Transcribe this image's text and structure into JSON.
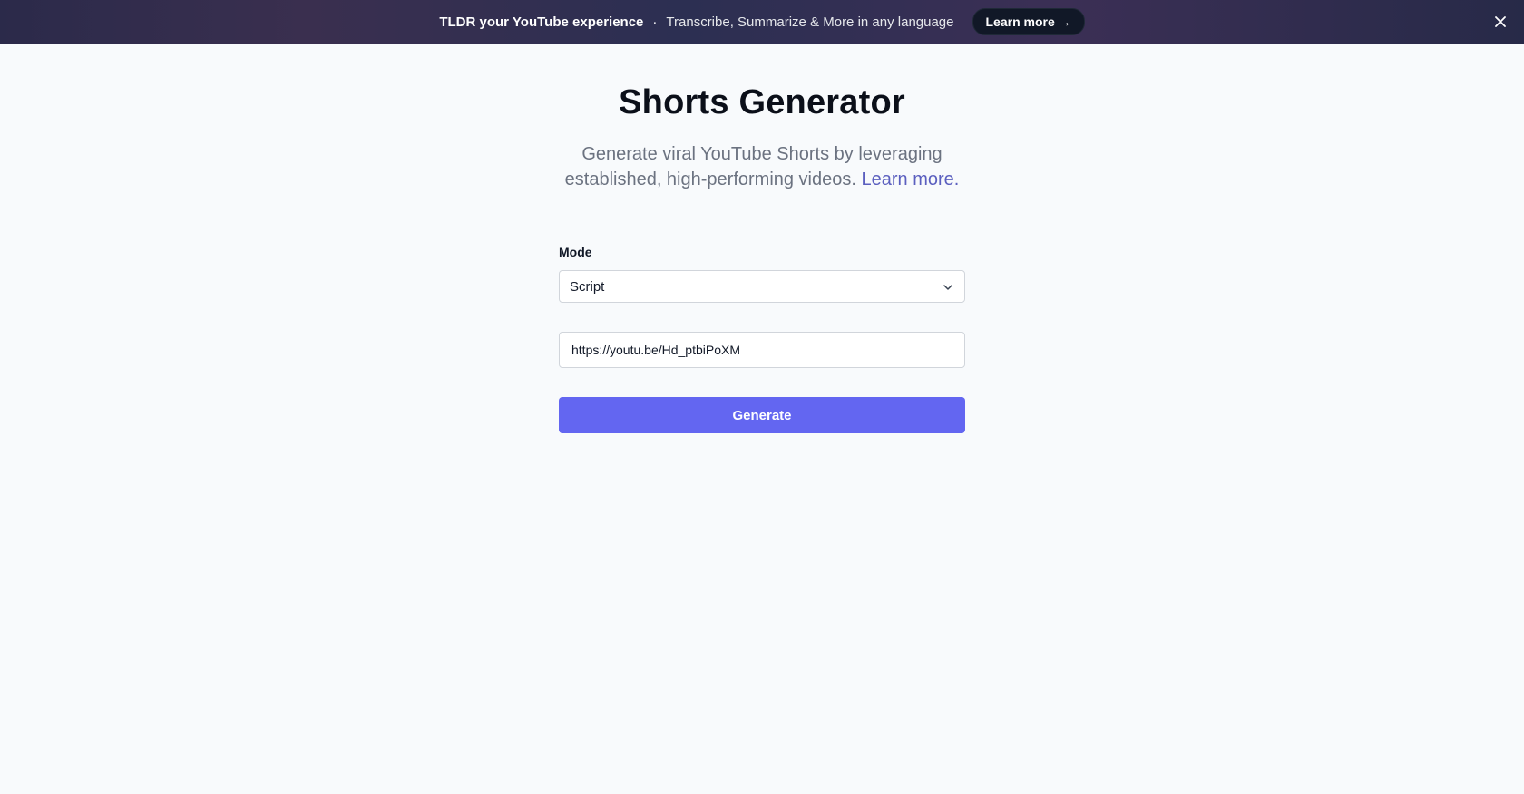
{
  "banner": {
    "title": "TLDR your YouTube experience",
    "separator": "·",
    "text": "Transcribe, Summarize & More in any language",
    "button_label": "Learn more →",
    "close_icon": "close-icon"
  },
  "page": {
    "title": "Shorts Generator",
    "subtitle": "Generate viral YouTube Shorts by leveraging established, high-performing videos.",
    "subtitle_link": "Learn more."
  },
  "form": {
    "mode_label": "Mode",
    "mode_value": "Script",
    "url_value": "https://youtu.be/Hd_ptbiPoXM",
    "generate_label": "Generate"
  },
  "colors": {
    "accent": "#6366f1",
    "link": "#5b5fbf",
    "banner_bg": "#2b2a4a",
    "background": "#f8fafc"
  }
}
